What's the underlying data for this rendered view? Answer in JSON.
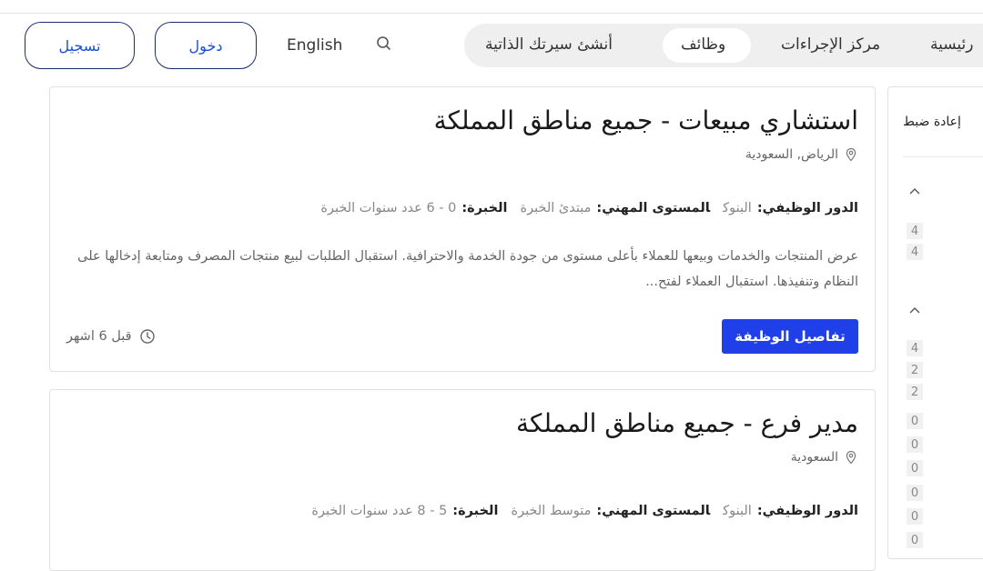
{
  "header": {
    "register_label": "تسجيل",
    "login_label": "دخول",
    "language_label": "English",
    "nav": {
      "create_cv": "أنشئ سيرتك الذاتية",
      "jobs": "وظائف",
      "procedures": "مركز الإجراءات",
      "home": "رئيسية"
    }
  },
  "jobs": [
    {
      "title": "استشاري مبيعات - جميع مناطق المملكة",
      "location": "الرياض, السعودية",
      "role_label": "الدور الوظيفي:",
      "role_value": "البنوك",
      "level_label": "المستوى المهني:",
      "level_value": "مبتدئ الخبرة",
      "exp_label": "الخبرة:",
      "exp_value": "0 - 6 عدد سنوات الخبرة",
      "description": "عرض المنتجات والخدمات وبيعها للعملاء بأعلى مستوى من جودة الخدمة والاحترافية. استقبال الطلبات لبيع منتجات المصرف ومتابعة إدخالها على النظام وتنفيذها. استقبال العملاء لفتح...",
      "details_label": "تفاصيل الوظيفة",
      "posted": "قبل 6 اشهر"
    },
    {
      "title": "مدير فرع - جميع مناطق المملكة",
      "location": "السعودية",
      "role_label": "الدور الوظيفي:",
      "role_value": "البنوك",
      "level_label": "المستوى المهني:",
      "level_value": "متوسط الخبرة",
      "exp_label": "الخبرة:",
      "exp_value": "5 - 8 عدد سنوات الخبرة"
    }
  ],
  "filters": {
    "reset_label": "إعادة ضبط",
    "group1_counts": [
      "4",
      "4"
    ],
    "group2_counts": [
      "4",
      "2",
      "2",
      "0",
      "0",
      "0",
      "0",
      "0",
      "0"
    ]
  },
  "colors": {
    "primary": "#1f3fe8",
    "outline": "#1a2d73",
    "nav_bg": "#efefef"
  }
}
